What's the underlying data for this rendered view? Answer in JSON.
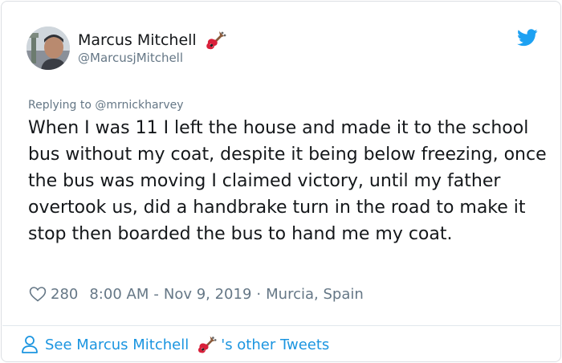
{
  "tweet": {
    "display_name": "Marcus Mitchell",
    "handle": "@MarcusjMitchell",
    "replying_prefix": "Replying to",
    "replying_to": "@mrnickharvey",
    "text": "When I was 11 I left the house and made it to the school bus without my coat, despite it being below freezing, once the bus was moving I claimed victory, until my father overtook us, did a handbrake turn in the road to make it stop then boarded the bus to hand me my coat.",
    "likes": "280",
    "time": "8:00 AM",
    "time_sep": "-",
    "date": "Nov 9, 2019",
    "dot": "·",
    "location": "Murcia, Spain",
    "display_name_emoji_icon": "guitar-icon"
  },
  "footer": {
    "link_prefix": "See Marcus Mitchell",
    "link_suffix": "'s other Tweets",
    "emoji_icon": "guitar-icon"
  },
  "colors": {
    "text": "#14171a",
    "secondary": "#657786",
    "link": "#1b95e0",
    "twitter_blue": "#1da1f2"
  },
  "icons": {
    "brand": "twitter-bird-icon",
    "like": "heart-outline-icon",
    "profile": "person-outline-icon"
  }
}
